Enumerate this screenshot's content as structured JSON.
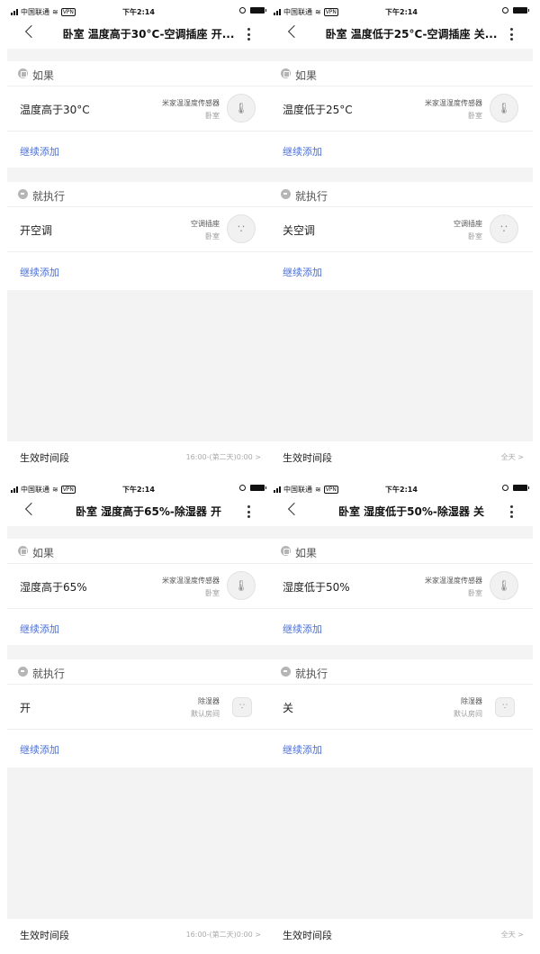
{
  "panels": [
    {
      "status": {
        "carrier": "中国联通",
        "vpn": "VPN",
        "time": "下午2:14"
      },
      "title": "卧室 温度高于30°C-空调插座 开...",
      "if_label": "如果",
      "condition": {
        "text": "温度高于30°C",
        "device": "米家温湿度传感器",
        "room": "卧室",
        "icon": "thermometer-icon"
      },
      "add1": "继续添加",
      "then_label": "就执行",
      "action": {
        "text": "开空调",
        "device": "空调插座",
        "room": "卧室",
        "icon": "ac-plug-icon"
      },
      "add2": "继续添加",
      "footer": {
        "label": "生效时间段",
        "value": "16:00-(第二天)0:00 >"
      }
    },
    {
      "status": {
        "carrier": "中国联通",
        "vpn": "VPN",
        "time": "下午2:14"
      },
      "title": "卧室 温度低于25°C-空调插座 关...",
      "if_label": "如果",
      "condition": {
        "text": "温度低于25°C",
        "device": "米家温湿度传感器",
        "room": "卧室",
        "icon": "thermometer-icon"
      },
      "add1": "继续添加",
      "then_label": "就执行",
      "action": {
        "text": "关空调",
        "device": "空调插座",
        "room": "卧室",
        "icon": "ac-plug-icon"
      },
      "add2": "继续添加",
      "footer": {
        "label": "生效时间段",
        "value": "全天 >"
      }
    },
    {
      "status": {
        "carrier": "中国联通",
        "vpn": "VPN",
        "time": "下午2:14"
      },
      "title": "卧室 湿度高于65%-除湿器 开",
      "if_label": "如果",
      "condition": {
        "text": "湿度高于65%",
        "device": "米家温湿度传感器",
        "room": "卧室",
        "icon": "thermometer-icon"
      },
      "add1": "继续添加",
      "then_label": "就执行",
      "action": {
        "text": "开",
        "device": "除湿器",
        "room": "默认房间",
        "icon": "dehumidifier-icon"
      },
      "add2": "继续添加",
      "footer": {
        "label": "生效时间段",
        "value": "16:00-(第二天)0:00 >"
      }
    },
    {
      "status": {
        "carrier": "中国联通",
        "vpn": "VPN",
        "time": "下午2:14"
      },
      "title": "卧室 湿度低于50%-除湿器 关",
      "if_label": "如果",
      "condition": {
        "text": "湿度低于50%",
        "device": "米家温湿度传感器",
        "room": "卧室",
        "icon": "thermometer-icon"
      },
      "add1": "继续添加",
      "then_label": "就执行",
      "action": {
        "text": "关",
        "device": "除湿器",
        "room": "默认房间",
        "icon": "dehumidifier-icon"
      },
      "add2": "继续添加",
      "footer": {
        "label": "生效时间段",
        "value": "全天 >"
      }
    }
  ]
}
